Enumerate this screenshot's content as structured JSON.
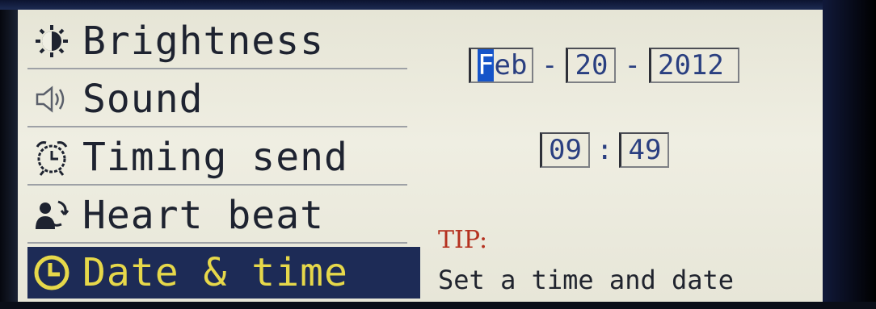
{
  "menu": {
    "items": [
      {
        "label": "Brightness",
        "icon": "brightness-icon"
      },
      {
        "label": "Sound",
        "icon": "speaker-icon"
      },
      {
        "label": "Timing send",
        "icon": "alarm-clock-icon"
      },
      {
        "label": "Heart beat",
        "icon": "heartbeat-person-icon"
      },
      {
        "label": "Date & time",
        "icon": "clock-icon"
      }
    ],
    "selected_index": 4
  },
  "date": {
    "month": "Feb",
    "month_cursor_char": "F",
    "month_rest": "eb",
    "day": "20",
    "year": "2012",
    "separator": "-"
  },
  "time": {
    "hour": "09",
    "minute": "49",
    "separator": ":"
  },
  "tip": {
    "title": "TIP:",
    "text": "Set a time and date"
  },
  "colors": {
    "screen_bg": "#e8e7d9",
    "selected_bg": "#1d2b56",
    "selected_text": "#e6d84a",
    "field_text": "#2a3f80",
    "cursor_bg": "#1554c9",
    "tip_title": "#b5311f"
  }
}
